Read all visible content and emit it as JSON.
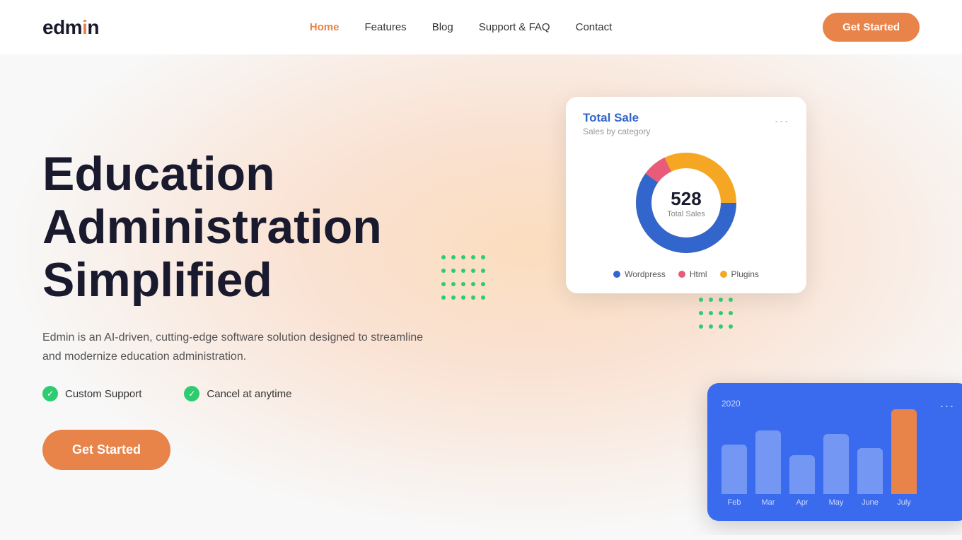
{
  "logo": {
    "text_main": "edmin",
    "dot_char": "·"
  },
  "nav": {
    "links": [
      {
        "label": "Home",
        "active": true
      },
      {
        "label": "Features",
        "active": false
      },
      {
        "label": "Blog",
        "active": false
      },
      {
        "label": "Support & FAQ",
        "active": false
      },
      {
        "label": "Contact",
        "active": false
      }
    ],
    "cta_label": "Get Started"
  },
  "hero": {
    "title_line1": "Education",
    "title_line2": "Administration",
    "title_line3": "Simplified",
    "description": "Edmin is an AI-driven, cutting-edge software solution designed to streamline and modernize education administration.",
    "feature1": "Custom Support",
    "feature2": "Cancel at anytime",
    "cta_label": "Get Started"
  },
  "donut_card": {
    "title": "Total Sale",
    "subtitle": "Sales by category",
    "total": "528",
    "total_label": "Total Sales",
    "legend": [
      {
        "label": "Wordpress",
        "color": "#3366cc"
      },
      {
        "label": "Html",
        "color": "#e85c7a"
      },
      {
        "label": "Plugins",
        "color": "#f5a623"
      }
    ],
    "dots": "..."
  },
  "bar_card": {
    "year": "2020",
    "dots": "...",
    "months": [
      "Feb",
      "Mar",
      "Apr",
      "May",
      "June",
      "July"
    ],
    "heights": [
      70,
      90,
      55,
      85,
      65,
      120
    ],
    "highlight_index": 5
  },
  "colors": {
    "accent_orange": "#e8834a",
    "accent_green": "#2ecc71",
    "blue_card": "#3a6bef",
    "donut_blue": "#3366cc",
    "donut_pink": "#e85c7a",
    "donut_orange": "#f5a623"
  }
}
